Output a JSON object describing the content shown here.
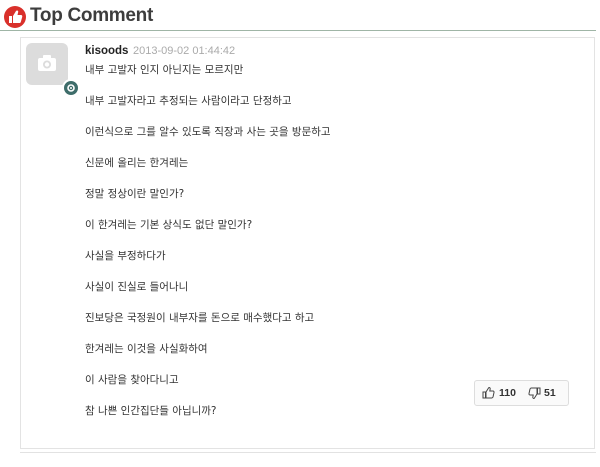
{
  "header": {
    "title": "Top Comment",
    "icon": "thumbs-up-icon",
    "accent": "#d9302b"
  },
  "comment": {
    "username": "kisoods",
    "timestamp": "2013-09-02 01:44:42",
    "avatar_icon": "camera-icon",
    "badge_icon": "gear-badge-icon",
    "lines": [
      "내부 고발자 인지 아닌지는 모르지만",
      "내부 고발자라고 추정되는 사람이라고 단정하고",
      "이런식으로 그를 알수 있도록 직장과 사는 곳을 방문하고",
      "신문에 올리는 한겨레는",
      "정말 정상이란 말인가?",
      "이 한겨레는 기본 상식도 없단 말인가?",
      "사실을 부정하다가",
      "사실이 진실로 들어나니",
      "진보당은 국정원이 내부자를 돈으로 매수했다고 하고",
      "한겨레는 이것을 사실화하여",
      "이 사람을 찾아다니고",
      "참 나쁜 인간집단들 아닙니까?"
    ],
    "likes": "110",
    "dislikes": "51"
  }
}
